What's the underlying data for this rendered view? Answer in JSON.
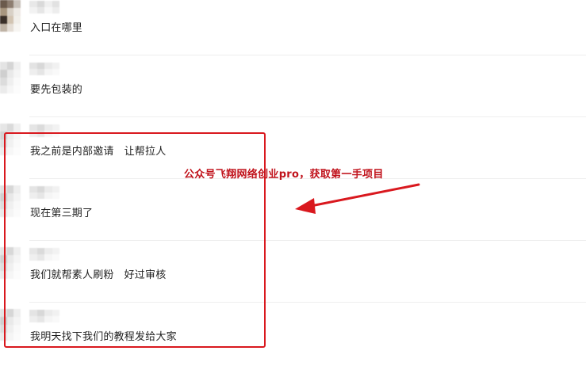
{
  "messages": [
    {
      "text": "入口在哪里"
    },
    {
      "text": "要先包装的"
    },
    {
      "text": "我之前是内部邀请   让帮拉人"
    },
    {
      "text": "现在第三期了"
    },
    {
      "text": "我们就帮素人刷粉   好过审核"
    },
    {
      "text": "我明天找下我们的教程发给大家"
    }
  ],
  "annotation": {
    "watermark_text": "公众号飞翔网络创业pro，获取第一手项目",
    "color": "#c0121b",
    "box_color": "#d9181e"
  }
}
